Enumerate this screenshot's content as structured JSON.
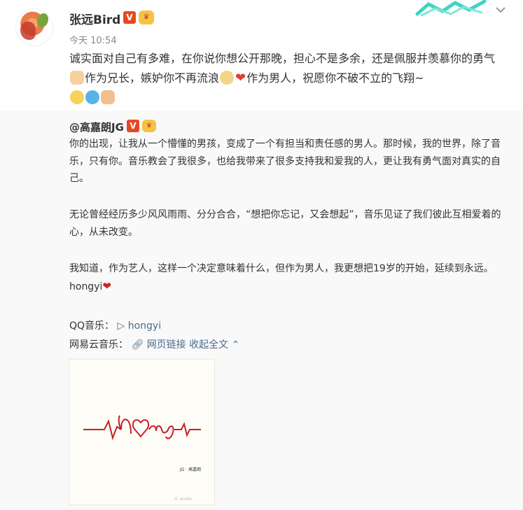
{
  "post": {
    "username": "张远Bird",
    "verified_badge": "V",
    "time": "今天 10:54",
    "text_segments": [
      "诚实面对自己有多难，在你说你想公开那晚，担心不是多余，还是佩服并羡慕你的勇气",
      "作为兄长，嫉妒你不再流浪",
      "作为男人，祝愿你不破不立的飞翔~"
    ],
    "menu_icon": "chevron-down-icon"
  },
  "repost": {
    "username": "@高嘉朗JG",
    "verified_badge": "V",
    "paragraph1": "你的出现，让我从一个懵懂的男孩，变成了一个有担当和责任感的男人。那时候，我的世界，除了音乐，只有你。音乐教会了我很多，也给我带来了很多支持我和爱我的人，更让我有勇气面对真实的自己。",
    "paragraph2": "无论曾经经历多少风风雨雨、分分合合，“想把你忘记，又会想起”，音乐见证了我们彼此互相爱着的心，从未改变。",
    "paragraph3": "我知道，作为艺人，这样一个决定意味着什么，但作为男人，我更想把19岁的开始，延续到永远。hongyi",
    "qq_label": "QQ音乐：",
    "qq_link": "▷ hongyi",
    "netease_label": "网易云音乐：",
    "netease_link": "网页链接",
    "collapse_label": "收起全文",
    "album_text": "hongyi",
    "album_artist": "JG · 高嘉朗"
  },
  "colors": {
    "accent_link": "#4a6b8a",
    "badge": "#e8481f",
    "heart": "#d81e1e"
  }
}
